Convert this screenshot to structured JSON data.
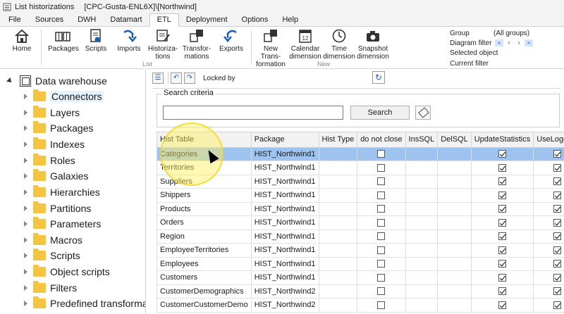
{
  "window": {
    "title": "List historizations",
    "context": "[CPC-Gusta-ENL6X]\\[Northwind]"
  },
  "menu": [
    "File",
    "Sources",
    "DWH",
    "Datamart",
    "ETL",
    "Deployment",
    "Options",
    "Help"
  ],
  "ribbon": {
    "home": "Home",
    "list_group": "List",
    "new_group": "New",
    "list_buttons": {
      "packages": "Packages",
      "scripts": "Scripts",
      "imports": "Imports",
      "historizations_1": "Historiza-",
      "historizations_2": "tions",
      "transformations_1": "Transfor-",
      "transformations_2": "mations",
      "exports": "Exports"
    },
    "new_buttons": {
      "newtrans_1": "New Trans-",
      "newtrans_2": "formation",
      "calendar_1": "Calendar",
      "calendar_2": "dimension",
      "time_1": "Time",
      "time_2": "dimension",
      "snapshot_1": "Snapshot",
      "snapshot_2": "dimension"
    },
    "info": {
      "group_label": "Group",
      "group_value": "(All groups)",
      "diagram_filter_label": "Diagram filter",
      "selected_object_label": "Selected object",
      "current_filter_label": "Current filter"
    }
  },
  "tree": {
    "root": "Data warehouse",
    "items": [
      "Connectors",
      "Layers",
      "Packages",
      "Indexes",
      "Roles",
      "Galaxies",
      "Hierarchies",
      "Partitions",
      "Parameters",
      "Macros",
      "Scripts",
      "Object scripts",
      "Filters",
      "Predefined transforma"
    ]
  },
  "toolbar": {
    "locked_by": "Locked by"
  },
  "search": {
    "legend": "Search criteria",
    "button": "Search",
    "input_value": ""
  },
  "grid": {
    "columns": [
      "Hist Table",
      "Package",
      "Hist Type",
      "do not close",
      "InsSQL",
      "DelSQL",
      "UpdateStatistics",
      "UseLogging"
    ],
    "rows": [
      {
        "table": "Categories",
        "package": "HIST_Northwind1",
        "hist_type": "",
        "do_not_close": false,
        "update_statistics": true,
        "use_logging": true
      },
      {
        "table": "Territories",
        "package": "HIST_Northwind1",
        "hist_type": "",
        "do_not_close": false,
        "update_statistics": true,
        "use_logging": true
      },
      {
        "table": "Suppliers",
        "package": "HIST_Northwind1",
        "hist_type": "",
        "do_not_close": false,
        "update_statistics": true,
        "use_logging": true
      },
      {
        "table": "Shippers",
        "package": "HIST_Northwind1",
        "hist_type": "",
        "do_not_close": false,
        "update_statistics": true,
        "use_logging": true
      },
      {
        "table": "Products",
        "package": "HIST_Northwind1",
        "hist_type": "",
        "do_not_close": false,
        "update_statistics": true,
        "use_logging": true
      },
      {
        "table": "Orders",
        "package": "HIST_Northwind1",
        "hist_type": "",
        "do_not_close": false,
        "update_statistics": true,
        "use_logging": true
      },
      {
        "table": "Region",
        "package": "HIST_Northwind1",
        "hist_type": "",
        "do_not_close": false,
        "update_statistics": true,
        "use_logging": true
      },
      {
        "table": "EmployeeTerritories",
        "package": "HIST_Northwind1",
        "hist_type": "",
        "do_not_close": false,
        "update_statistics": true,
        "use_logging": true
      },
      {
        "table": "Employees",
        "package": "HIST_Northwind1",
        "hist_type": "",
        "do_not_close": false,
        "update_statistics": true,
        "use_logging": true
      },
      {
        "table": "Customers",
        "package": "HIST_Northwind1",
        "hist_type": "",
        "do_not_close": false,
        "update_statistics": true,
        "use_logging": true
      },
      {
        "table": "CustomerDemographics",
        "package": "HIST_Northwind2",
        "hist_type": "",
        "do_not_close": false,
        "update_statistics": true,
        "use_logging": true
      },
      {
        "table": "CustomerCustomerDemo",
        "package": "HIST_Northwind2",
        "hist_type": "",
        "do_not_close": false,
        "update_statistics": true,
        "use_logging": true
      }
    ]
  },
  "colors": {
    "selection": "#9ec3ee",
    "folder": "#f5c542",
    "accent": "#1a5fb4"
  }
}
